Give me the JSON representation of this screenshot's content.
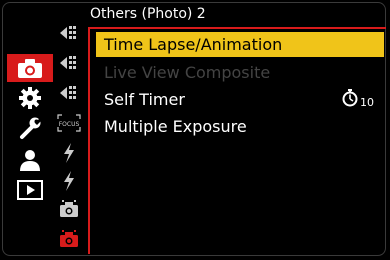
{
  "menu": {
    "title": "Others (Photo) 2",
    "categories": [
      {
        "icon": "camera-icon",
        "active": true
      },
      {
        "icon": "gear-icon",
        "active": false
      },
      {
        "icon": "wrench-icon",
        "active": false
      },
      {
        "icon": "person-icon",
        "active": false
      },
      {
        "icon": "playback-icon",
        "active": false
      }
    ],
    "subtabs": [
      {
        "icon": "af-area-icon"
      },
      {
        "icon": "af-area-icon"
      },
      {
        "icon": "af-area-icon"
      },
      {
        "icon": "focus-icon",
        "label": "FOCUS"
      },
      {
        "icon": "flash-icon"
      },
      {
        "icon": "flash-icon"
      },
      {
        "icon": "camera-small-icon"
      },
      {
        "icon": "camera-small-active-icon",
        "active": true
      }
    ],
    "items": [
      {
        "label": "Time Lapse/Animation",
        "state": "selected"
      },
      {
        "label": "Live View Composite",
        "state": "disabled"
      },
      {
        "label": "Self Timer",
        "state": "normal",
        "value": "10",
        "value_icon": "self-timer-icon"
      },
      {
        "label": "Multiple Exposure",
        "state": "normal"
      }
    ],
    "colors": {
      "accent_red": "#d81b1b",
      "highlight": "#f0c419",
      "disabled_text": "#444444"
    }
  }
}
